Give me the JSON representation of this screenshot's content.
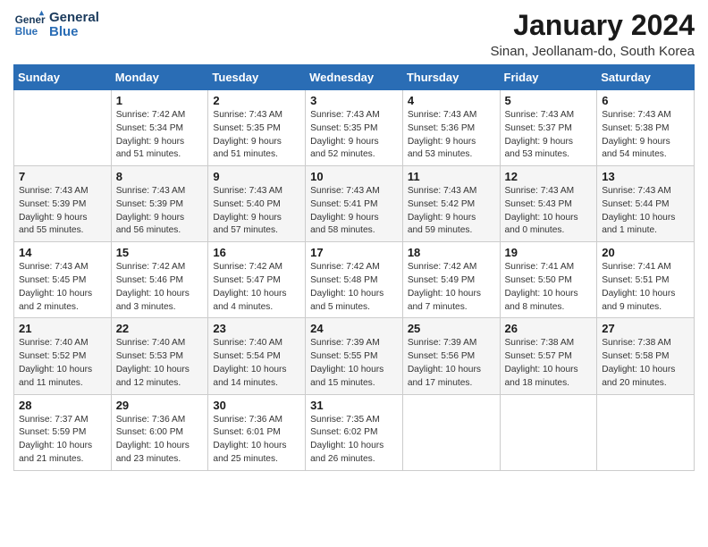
{
  "header": {
    "logo_line1": "General",
    "logo_line2": "Blue",
    "month_title": "January 2024",
    "location": "Sinan, Jeollanam-do, South Korea"
  },
  "columns": [
    "Sunday",
    "Monday",
    "Tuesday",
    "Wednesday",
    "Thursday",
    "Friday",
    "Saturday"
  ],
  "weeks": [
    [
      {
        "day": "",
        "info": ""
      },
      {
        "day": "1",
        "info": "Sunrise: 7:42 AM\nSunset: 5:34 PM\nDaylight: 9 hours\nand 51 minutes."
      },
      {
        "day": "2",
        "info": "Sunrise: 7:43 AM\nSunset: 5:35 PM\nDaylight: 9 hours\nand 51 minutes."
      },
      {
        "day": "3",
        "info": "Sunrise: 7:43 AM\nSunset: 5:35 PM\nDaylight: 9 hours\nand 52 minutes."
      },
      {
        "day": "4",
        "info": "Sunrise: 7:43 AM\nSunset: 5:36 PM\nDaylight: 9 hours\nand 53 minutes."
      },
      {
        "day": "5",
        "info": "Sunrise: 7:43 AM\nSunset: 5:37 PM\nDaylight: 9 hours\nand 53 minutes."
      },
      {
        "day": "6",
        "info": "Sunrise: 7:43 AM\nSunset: 5:38 PM\nDaylight: 9 hours\nand 54 minutes."
      }
    ],
    [
      {
        "day": "7",
        "info": "Sunrise: 7:43 AM\nSunset: 5:39 PM\nDaylight: 9 hours\nand 55 minutes."
      },
      {
        "day": "8",
        "info": "Sunrise: 7:43 AM\nSunset: 5:39 PM\nDaylight: 9 hours\nand 56 minutes."
      },
      {
        "day": "9",
        "info": "Sunrise: 7:43 AM\nSunset: 5:40 PM\nDaylight: 9 hours\nand 57 minutes."
      },
      {
        "day": "10",
        "info": "Sunrise: 7:43 AM\nSunset: 5:41 PM\nDaylight: 9 hours\nand 58 minutes."
      },
      {
        "day": "11",
        "info": "Sunrise: 7:43 AM\nSunset: 5:42 PM\nDaylight: 9 hours\nand 59 minutes."
      },
      {
        "day": "12",
        "info": "Sunrise: 7:43 AM\nSunset: 5:43 PM\nDaylight: 10 hours\nand 0 minutes."
      },
      {
        "day": "13",
        "info": "Sunrise: 7:43 AM\nSunset: 5:44 PM\nDaylight: 10 hours\nand 1 minute."
      }
    ],
    [
      {
        "day": "14",
        "info": "Sunrise: 7:43 AM\nSunset: 5:45 PM\nDaylight: 10 hours\nand 2 minutes."
      },
      {
        "day": "15",
        "info": "Sunrise: 7:42 AM\nSunset: 5:46 PM\nDaylight: 10 hours\nand 3 minutes."
      },
      {
        "day": "16",
        "info": "Sunrise: 7:42 AM\nSunset: 5:47 PM\nDaylight: 10 hours\nand 4 minutes."
      },
      {
        "day": "17",
        "info": "Sunrise: 7:42 AM\nSunset: 5:48 PM\nDaylight: 10 hours\nand 5 minutes."
      },
      {
        "day": "18",
        "info": "Sunrise: 7:42 AM\nSunset: 5:49 PM\nDaylight: 10 hours\nand 7 minutes."
      },
      {
        "day": "19",
        "info": "Sunrise: 7:41 AM\nSunset: 5:50 PM\nDaylight: 10 hours\nand 8 minutes."
      },
      {
        "day": "20",
        "info": "Sunrise: 7:41 AM\nSunset: 5:51 PM\nDaylight: 10 hours\nand 9 minutes."
      }
    ],
    [
      {
        "day": "21",
        "info": "Sunrise: 7:40 AM\nSunset: 5:52 PM\nDaylight: 10 hours\nand 11 minutes."
      },
      {
        "day": "22",
        "info": "Sunrise: 7:40 AM\nSunset: 5:53 PM\nDaylight: 10 hours\nand 12 minutes."
      },
      {
        "day": "23",
        "info": "Sunrise: 7:40 AM\nSunset: 5:54 PM\nDaylight: 10 hours\nand 14 minutes."
      },
      {
        "day": "24",
        "info": "Sunrise: 7:39 AM\nSunset: 5:55 PM\nDaylight: 10 hours\nand 15 minutes."
      },
      {
        "day": "25",
        "info": "Sunrise: 7:39 AM\nSunset: 5:56 PM\nDaylight: 10 hours\nand 17 minutes."
      },
      {
        "day": "26",
        "info": "Sunrise: 7:38 AM\nSunset: 5:57 PM\nDaylight: 10 hours\nand 18 minutes."
      },
      {
        "day": "27",
        "info": "Sunrise: 7:38 AM\nSunset: 5:58 PM\nDaylight: 10 hours\nand 20 minutes."
      }
    ],
    [
      {
        "day": "28",
        "info": "Sunrise: 7:37 AM\nSunset: 5:59 PM\nDaylight: 10 hours\nand 21 minutes."
      },
      {
        "day": "29",
        "info": "Sunrise: 7:36 AM\nSunset: 6:00 PM\nDaylight: 10 hours\nand 23 minutes."
      },
      {
        "day": "30",
        "info": "Sunrise: 7:36 AM\nSunset: 6:01 PM\nDaylight: 10 hours\nand 25 minutes."
      },
      {
        "day": "31",
        "info": "Sunrise: 7:35 AM\nSunset: 6:02 PM\nDaylight: 10 hours\nand 26 minutes."
      },
      {
        "day": "",
        "info": ""
      },
      {
        "day": "",
        "info": ""
      },
      {
        "day": "",
        "info": ""
      }
    ]
  ]
}
